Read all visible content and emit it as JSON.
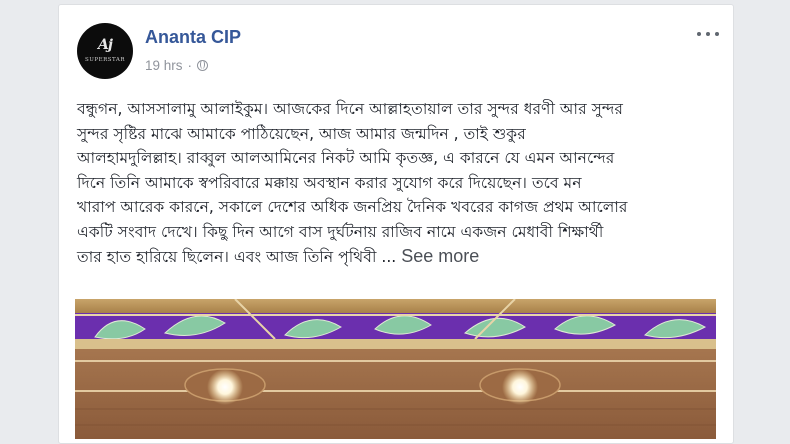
{
  "post": {
    "author_name": "Ananta CIP",
    "timestamp": "19 hrs",
    "separator": "·",
    "privacy_icon": "globe-icon",
    "options_icon": "more-options-icon",
    "avatar": {
      "monogram": "Aj",
      "caption": "SUPERSTAR"
    },
    "text_lines": [
      "বন্ধুগন, আসসালামু আলাইকুম। আজকের দিনে আল্লাহতায়াল তার সুন্দর ধরণী আর সুন্দর",
      "সুন্দর সৃষ্টির মাঝে আমাকে পাঠিয়েছেন, আজ আমার জন্মদিন , তাই শুকুর",
      "আলহামদুলিল্লাহ। রাব্বুল আলআমিনের নিকট আমি কৃতজ্ঞ, এ কারনে যে এমন আনন্দের",
      "দিনে তিনি আমাকে স্বপরিবারে মক্কায় অবস্থান করার সুযোগ করে দিয়েছেন। তবে মন",
      "খারাপ আরেক কারনে, সকালে দেশের অধিক জনপ্রিয় দৈনিক খবরের কাগজ প্রথম আলোর",
      "একটি সংবাদ দেখে। কিছু দিন আগে বাস দুর্ঘটনায় রাজিব নামে একজন মেধাবী শিক্ষার্থী",
      "তার হাত হারিয়ে ছিলেন। এবং আজ তিনি পৃথিবী ..."
    ],
    "see_more_label": "See more"
  }
}
